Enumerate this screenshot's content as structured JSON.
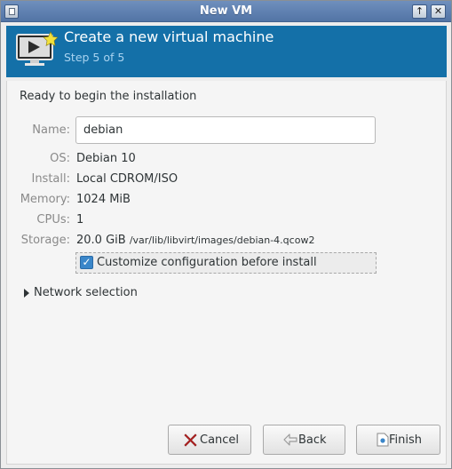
{
  "window": {
    "title": "New VM",
    "menu_icon": "window-menu-icon",
    "maximize_glyph": "↑",
    "close_glyph": "✕"
  },
  "header": {
    "icon": "monitor-star-icon",
    "title": "Create a new virtual machine",
    "step": "Step 5 of 5",
    "background": "#1470a8"
  },
  "summary": {
    "heading": "Ready to begin the installation",
    "name_label": "Name:",
    "name_value": "debian",
    "os_label": "OS:",
    "os_value": "Debian 10",
    "install_label": "Install:",
    "install_value": "Local CDROM/ISO",
    "memory_label": "Memory:",
    "memory_value": "1024 MiB",
    "cpus_label": "CPUs:",
    "cpus_value": "1",
    "storage_label": "Storage:",
    "storage_size": "20.0 GiB",
    "storage_path": "/var/lib/libvirt/images/debian-4.qcow2",
    "customize_label": "Customize configuration before install",
    "customize_checked": true
  },
  "network": {
    "expander_label": "Network selection",
    "expanded": false
  },
  "buttons": {
    "cancel": "Cancel",
    "back": "Back",
    "finish": "Finish"
  },
  "colors": {
    "accent": "#3a86c9",
    "titlebar": "#5f80b1",
    "cancel_icon": "#cc2a2a"
  }
}
